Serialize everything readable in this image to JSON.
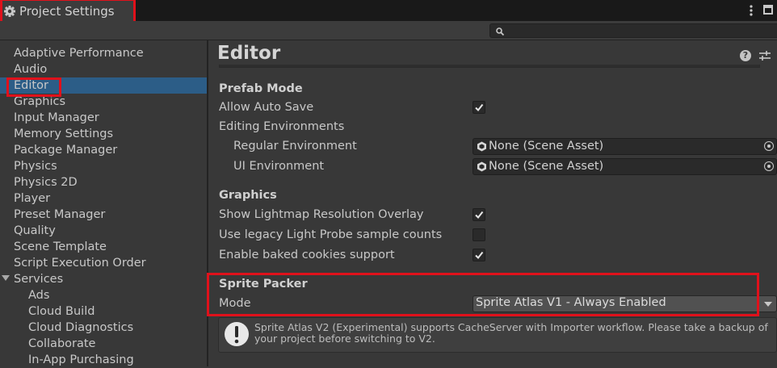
{
  "window": {
    "tab_title": "Project Settings",
    "search": {
      "value": "",
      "placeholder": ""
    }
  },
  "sidebar": {
    "items": [
      {
        "label": "Adaptive Performance"
      },
      {
        "label": "Audio"
      },
      {
        "label": "Editor",
        "selected": true
      },
      {
        "label": "Graphics"
      },
      {
        "label": "Input Manager"
      },
      {
        "label": "Memory Settings"
      },
      {
        "label": "Package Manager"
      },
      {
        "label": "Physics"
      },
      {
        "label": "Physics 2D"
      },
      {
        "label": "Player"
      },
      {
        "label": "Preset Manager"
      },
      {
        "label": "Quality"
      },
      {
        "label": "Scene Template"
      },
      {
        "label": "Script Execution Order"
      },
      {
        "label": "Services",
        "expanded": true
      }
    ],
    "services_children": [
      {
        "label": "Ads"
      },
      {
        "label": "Cloud Build"
      },
      {
        "label": "Cloud Diagnostics"
      },
      {
        "label": "Collaborate"
      },
      {
        "label": "In-App Purchasing"
      }
    ]
  },
  "main": {
    "title": "Editor",
    "prefab_mode": {
      "heading": "Prefab Mode",
      "allow_auto_save": {
        "label": "Allow Auto Save",
        "checked": true
      },
      "editing_environments": {
        "label": "Editing Environments"
      },
      "regular_environment": {
        "label": "Regular Environment",
        "value": "None (Scene Asset)"
      },
      "ui_environment": {
        "label": "UI Environment",
        "value": "None (Scene Asset)"
      }
    },
    "graphics": {
      "heading": "Graphics",
      "show_lightmap": {
        "label": "Show Lightmap Resolution Overlay",
        "checked": true
      },
      "legacy_light_probe": {
        "label": "Use legacy Light Probe sample counts",
        "checked": false
      },
      "baked_cookies": {
        "label": "Enable baked cookies support",
        "checked": true
      }
    },
    "sprite_packer": {
      "heading": "Sprite Packer",
      "mode": {
        "label": "Mode",
        "value": "Sprite Atlas V1 - Always Enabled"
      }
    },
    "help_box": {
      "text": "Sprite Atlas V2 (Experimental) supports CacheServer with Importer workflow. Please take a backup of your project before switching to V2."
    }
  },
  "colors": {
    "highlight": "#e0111b",
    "selection": "#2c5d87",
    "background": "#383838"
  },
  "icons": [
    "gear-icon",
    "kebab-menu-icon",
    "maximize-icon",
    "search-icon",
    "help-icon",
    "preset-icon",
    "unity-scene-icon",
    "object-picker-icon",
    "dropdown-arrow-icon",
    "warning-icon",
    "checkmark-icon"
  ]
}
